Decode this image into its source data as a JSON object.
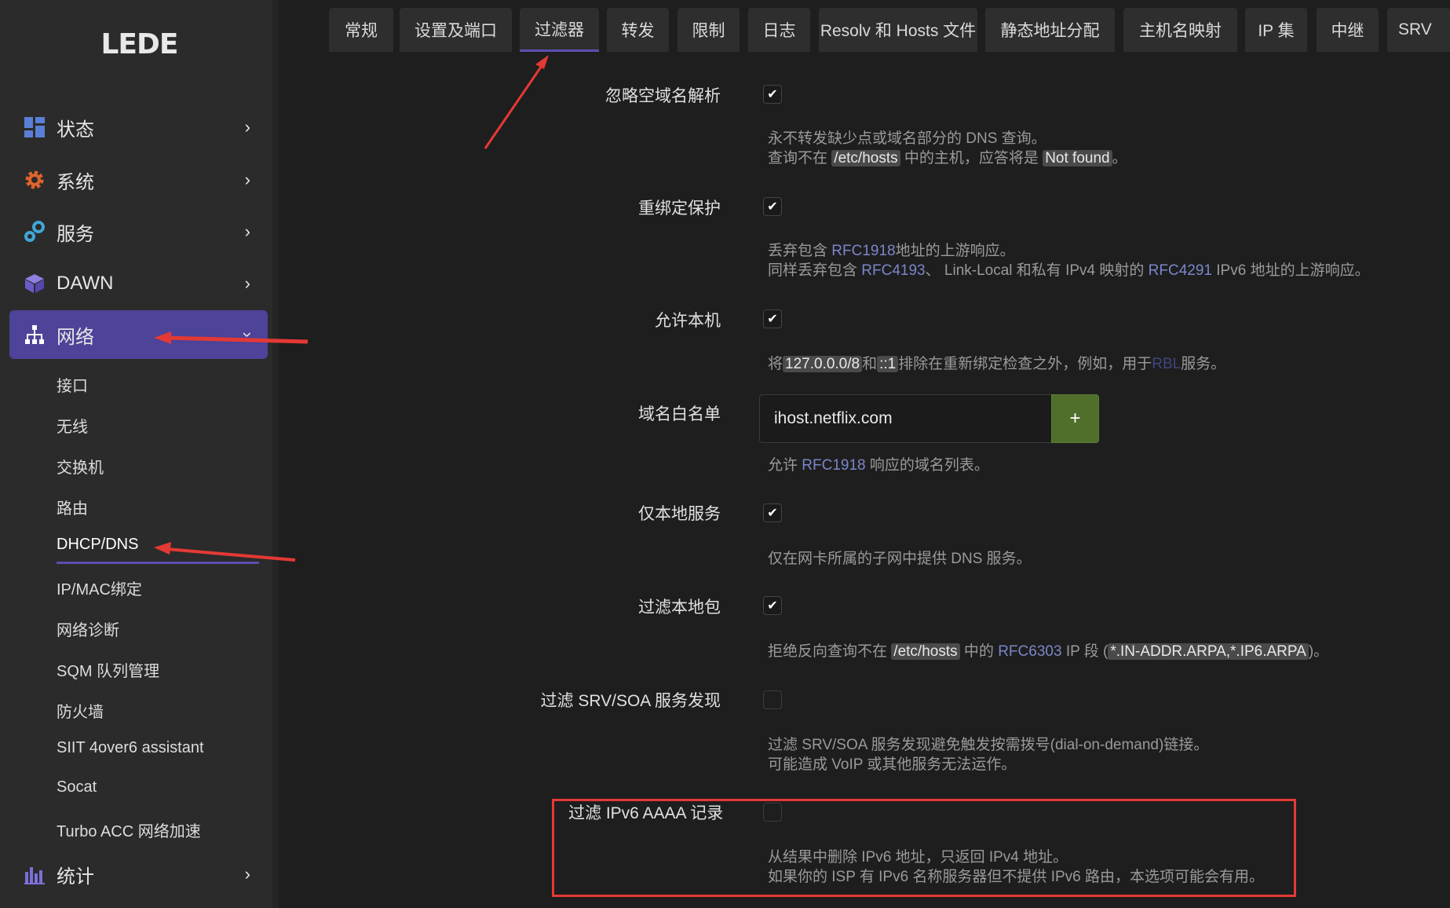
{
  "brand": {
    "logo": "LEDE"
  },
  "sidebar": {
    "items": [
      {
        "label": "状态",
        "icon": "dashboard-icon"
      },
      {
        "label": "系统",
        "icon": "gear-icon"
      },
      {
        "label": "服务",
        "icon": "services-icon"
      },
      {
        "label": "DAWN",
        "icon": "cube-icon"
      },
      {
        "label": "网络",
        "icon": "network-icon",
        "expanded": true
      },
      {
        "label": "统计",
        "icon": "bar-chart-icon"
      }
    ],
    "network_sub": [
      "接口",
      "无线",
      "交换机",
      "路由",
      "DHCP/DNS",
      "IP/MAC绑定",
      "网络诊断",
      "SQM 队列管理",
      "防火墙",
      "SIIT 4over6 assistant",
      "Socat",
      "Turbo ACC 网络加速"
    ],
    "active_sub": "DHCP/DNS"
  },
  "tabs": {
    "items": [
      "常规",
      "设置及端口",
      "过滤器",
      "转发",
      "限制",
      "日志",
      "Resolv 和 Hosts 文件",
      "静态地址分配",
      "主机名映射",
      "IP 集",
      "中继",
      "SRV"
    ],
    "active": "过滤器"
  },
  "settings": {
    "ignore_empty": {
      "label": "忽略空域名解析",
      "checked": true,
      "desc1": "永不转发缺少点或域名部分的 DNS 查询。",
      "desc2_a": "查询不在",
      "desc2_code": "/etc/hosts",
      "desc2_b": "中的主机，应答将是",
      "desc2_code2": "Not found",
      "desc2_c": "。"
    },
    "rebind": {
      "label": "重绑定保护",
      "checked": true,
      "desc1_a": "丢弃包含",
      "desc1_link": "RFC1918",
      "desc1_b": "地址的上游响应。",
      "desc2_a": "同样丢弃包含",
      "desc2_link1": "RFC4193",
      "desc2_b": "、 Link-Local 和私有 IPv4 映射的",
      "desc2_link2": "RFC4291",
      "desc2_c": "IPv6 地址的上游响应。"
    },
    "allow_localhost": {
      "label": "允许本机",
      "checked": true,
      "desc_a": "将",
      "desc_code1": "127.0.0.0/8",
      "desc_b": "和",
      "desc_code2": "::1",
      "desc_c": "排除在重新绑定检查之外，例如，用于",
      "desc_link": "RBL",
      "desc_d": "服务。"
    },
    "domain_whitelist": {
      "label": "域名白名单",
      "value": "ihost.netflix.com",
      "add_label": "+",
      "desc_a": "允许",
      "desc_link": "RFC1918",
      "desc_b": "响应的域名列表。"
    },
    "local_service": {
      "label": "仅本地服务",
      "checked": true,
      "desc": "仅在网卡所属的子网中提供 DNS 服务。"
    },
    "filter_private": {
      "label": "过滤本地包",
      "checked": true,
      "desc_a": "拒绝反向查询不在",
      "desc_code1": "/etc/hosts",
      "desc_b": "中的",
      "desc_link": "RFC6303",
      "desc_c": "IP 段 (",
      "desc_code2": "*.IN-ADDR.ARPA,*.IP6.ARPA",
      "desc_d": ")。"
    },
    "filter_srv": {
      "label": "过滤 SRV/SOA 服务发现",
      "checked": false,
      "desc1": "过滤 SRV/SOA 服务发现避免触发按需拨号(dial-on-demand)链接。",
      "desc2": "可能造成 VoIP 或其他服务无法运作。"
    },
    "filter_aaaa": {
      "label": "过滤 IPv6 AAAA 记录",
      "checked": false,
      "desc1": "从结果中删除 IPv6 地址，只返回 IPv4 地址。",
      "desc2": "如果你的 ISP 有 IPv6 名称服务器但不提供 IPv6 路由，本选项可能会有用。"
    }
  },
  "colors": {
    "accent": "#4d4398",
    "annotation": "#e53935",
    "add_button": "#4f6f2a"
  }
}
